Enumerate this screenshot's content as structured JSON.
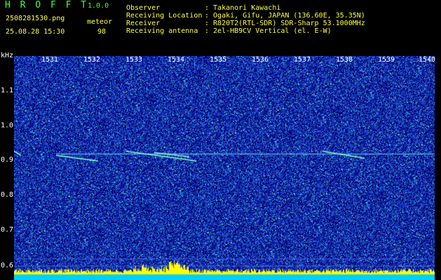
{
  "app": {
    "logo": "H R O F F T",
    "version": "1.0.0",
    "filename": "2508281530.png",
    "datetime": "25.08.28 15:30",
    "mode_label": "meteor",
    "meteor_count": "98"
  },
  "info": {
    "labels": [
      "Observer",
      "Receiving Location",
      "Receiver",
      "Receiving antenna"
    ],
    "values": [
      ": Takanori Kawachi",
      ": Ogaki, Gifu, JAPAN (136.60E, 35.35N)",
      ": R820T2(RTL-SDR) SDR-Sharp 53.1000MHz",
      ": 2el-HB9CV Vertical (el. E-W)"
    ]
  },
  "axis": {
    "unit": "kHz",
    "x_ticks": [
      "1531",
      "1532",
      "1533",
      "1534",
      "1535",
      "1536",
      "1537",
      "1538",
      "1539",
      "1540"
    ],
    "y_ticks": [
      "1.1",
      "1.0",
      "0.9",
      "0.8",
      "0.7",
      "0.6"
    ]
  },
  "colors": {
    "background": "#000000",
    "spectrum": "#1b2fb0",
    "text_yellow": "#ffff40",
    "text_green": "#40ff40",
    "signal": "#60e0ff",
    "level_bar": "#ffff00",
    "base_bar": "#00d0ff"
  }
}
